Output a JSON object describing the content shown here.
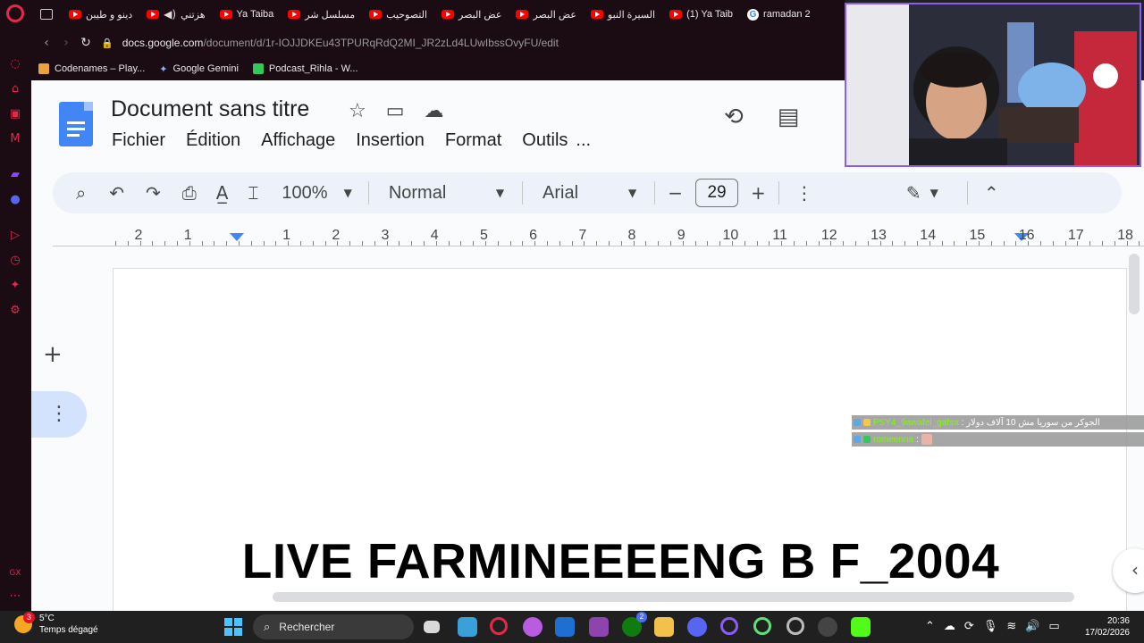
{
  "browser": {
    "tabs": [
      {
        "label": "دينو و طيبن",
        "icon": "youtube"
      },
      {
        "label": "هزتني",
        "icon": "youtube"
      },
      {
        "label": "Ya Taiba",
        "icon": "youtube"
      },
      {
        "label": "مسلسل شر",
        "icon": "youtube"
      },
      {
        "label": "التصوحيب",
        "icon": "youtube"
      },
      {
        "label": "عض البصر",
        "icon": "youtube"
      },
      {
        "label": "عض البصر",
        "icon": "youtube"
      },
      {
        "label": "السيرة النبو",
        "icon": "youtube"
      },
      {
        "label": "(1) Ya Taib",
        "icon": "youtube"
      },
      {
        "label": "ramadan 2",
        "icon": "google"
      }
    ],
    "url_host": "docs.google.com",
    "url_path": "/document/d/1r-IOJJDKEu43TPURqRdQ2MI_JR2zLd4LUwIbssOvyFU/edit",
    "bookmarks": [
      {
        "label": "Codenames – Play...",
        "color": "#e8a33b"
      },
      {
        "label": "Google Gemini",
        "color": "#8ab4f8"
      },
      {
        "label": "Podcast_Rihla - W...",
        "color": "#34c759"
      }
    ]
  },
  "docs": {
    "title": "Document sans titre",
    "menu": [
      "Fichier",
      "Édition",
      "Affichage",
      "Insertion",
      "Format",
      "Outils",
      "..."
    ],
    "toolbar": {
      "zoom": "100%",
      "style": "Normal",
      "font": "Arial",
      "font_size": "29"
    },
    "ruler_numbers": [
      "2",
      "1",
      "1",
      "2",
      "3",
      "4",
      "5",
      "6",
      "7",
      "8",
      "9",
      "10",
      "11",
      "12",
      "13",
      "14",
      "15",
      "16",
      "17",
      "18"
    ],
    "headline": "LIVE FARMINEEEENG B F_2004"
  },
  "chat": [
    {
      "user": "PSY4_9awafel_gafsa",
      "message": ": الجوكر من سوريا مش 10 آلاف دولار"
    },
    {
      "user": "romeenna",
      "message": ":"
    }
  ],
  "taskbar": {
    "weather_temp": "5°C",
    "weather_desc": "Temps dégagé",
    "weather_badge": "3",
    "search_placeholder": "Rechercher",
    "time": "20:36",
    "date": "17/02/2026",
    "xbox_badge": "2"
  },
  "colors": {
    "opera_red": "#e3294a",
    "docs_blue": "#4285f4",
    "toolbar_bg": "#edf2fa",
    "webcam_border": "#8b5cf6"
  }
}
